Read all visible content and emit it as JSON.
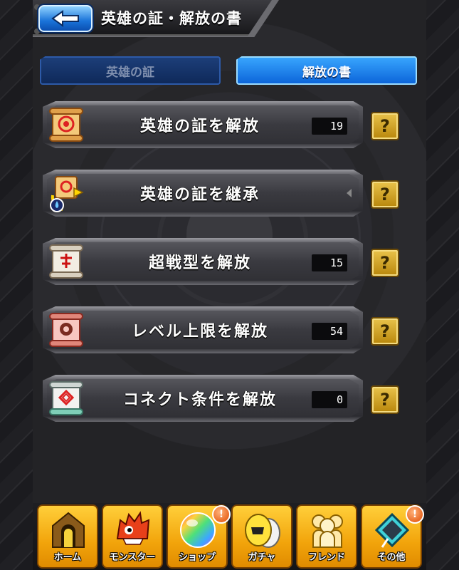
{
  "header": {
    "title": "英雄の証・解放の書"
  },
  "tabs": [
    {
      "label": "英雄の証",
      "active": false
    },
    {
      "label": "解放の書",
      "active": true
    }
  ],
  "rows": [
    {
      "label": "英雄の証を解放",
      "count": "19",
      "icon": "scroll-red-icon"
    },
    {
      "label": "英雄の証を継承",
      "count": "",
      "icon": "scroll-inherit-icon"
    },
    {
      "label": "超戦型を解放",
      "count": "15",
      "icon": "scroll-white-icon"
    },
    {
      "label": "レベル上限を解放",
      "count": "54",
      "icon": "scroll-pink-icon"
    },
    {
      "label": "コネクト条件を解放",
      "count": "0",
      "icon": "scroll-green-icon"
    }
  ],
  "help_symbol": "?",
  "nav": [
    {
      "label": "ホーム",
      "icon": "home-icon",
      "badge": ""
    },
    {
      "label": "モンスター",
      "icon": "monster-icon",
      "badge": ""
    },
    {
      "label": "ショップ",
      "icon": "orb-icon",
      "badge": "!"
    },
    {
      "label": "ガチャ",
      "icon": "gacha-egg-icon",
      "badge": ""
    },
    {
      "label": "フレンド",
      "icon": "friends-icon",
      "badge": ""
    },
    {
      "label": "その他",
      "icon": "other-icon",
      "badge": "!"
    }
  ]
}
